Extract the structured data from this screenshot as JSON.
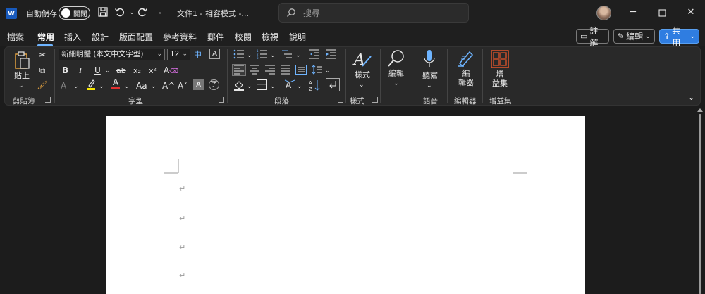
{
  "titlebar": {
    "app_logo": "W",
    "autosave_label": "自動儲存",
    "autosave_state": "關閉",
    "doc_title": "文件1 - 相容模式 -...",
    "search_placeholder": "搜尋",
    "icons": [
      "save-icon",
      "undo-icon",
      "redo-icon",
      "customize-icon",
      "search-icon",
      "minimize-icon",
      "maximize-icon",
      "close-icon"
    ]
  },
  "menu": {
    "tabs": [
      "檔案",
      "常用",
      "插入",
      "設計",
      "版面配置",
      "參考資料",
      "郵件",
      "校閱",
      "檢視",
      "說明"
    ],
    "active_tab": "常用",
    "comments_label": "註解",
    "editing_label": "編輯",
    "share_label": "共用"
  },
  "ribbon": {
    "clipboard": {
      "paste_label": "貼上",
      "group_label": "剪貼簿"
    },
    "font": {
      "font_name": "新細明體 (本文中文字型)",
      "font_size": "12",
      "phonetic": "中",
      "bold": "B",
      "italic": "I",
      "underline": "U",
      "strike": "ab",
      "subscript": "x₂",
      "superscript": "x²",
      "font_color": "A",
      "change_case": "Aa",
      "grow": "A^",
      "shrink": "A˅",
      "group_label": "字型"
    },
    "paragraph": {
      "group_label": "段落"
    },
    "styles": {
      "label": "樣式",
      "group_label": "樣式"
    },
    "editing": {
      "label": "編輯"
    },
    "voice": {
      "dictate_label": "聽寫",
      "group_label": "語音"
    },
    "editor": {
      "label_line1": "編",
      "label_line2": "輯器",
      "group_label": "編輯器"
    },
    "addins": {
      "label_line1": "增",
      "label_line2": "益集",
      "group_label": "增益集"
    }
  },
  "document": {
    "paragraph_marks": [
      "↵",
      "↵",
      "↵",
      "↵"
    ]
  },
  "colors": {
    "accent_blue": "#2f7de1",
    "tab_underline": "#6eb4ff",
    "highlight_yellow": "#f5e400",
    "font_red": "#e03030",
    "addins_orange": "#e0552c"
  }
}
